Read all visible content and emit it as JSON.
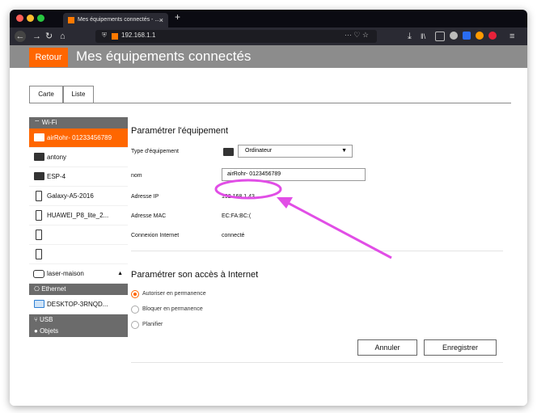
{
  "browser": {
    "tab_title": "Mes équipements connectés - ...",
    "tab_close": "×",
    "new_tab": "+",
    "url": "192.168.1.1",
    "url_menu": "··· ♡ ☆"
  },
  "page": {
    "back_label": "Retour",
    "title": "Mes équipements connectés",
    "tabs": [
      {
        "label": "Carte",
        "active": false
      },
      {
        "label": "Liste",
        "active": true
      }
    ]
  },
  "sidebar": {
    "wifi_label": "Wi-Fi",
    "wifi_items": [
      {
        "label": "airRohr- 01233456789",
        "icon": "computer-icon",
        "active": true
      },
      {
        "label": "antony",
        "icon": "computer-icon",
        "active": false
      },
      {
        "label": "ESP-4",
        "icon": "computer-icon",
        "active": false
      },
      {
        "label": "Galaxy-A5-2016",
        "icon": "phone-icon",
        "active": false
      },
      {
        "label": "HUAWEI_P8_lite_2...",
        "icon": "phone-icon",
        "active": false
      },
      {
        "label": "",
        "icon": "phone-icon",
        "active": false
      },
      {
        "label": "",
        "icon": "phone-icon",
        "active": false
      },
      {
        "label": "laser-maison",
        "icon": "printer-icon",
        "active": false
      }
    ],
    "ethernet_label": "Ethernet",
    "ethernet_items": [
      {
        "label": "DESKTOP-3RNQD...",
        "icon": "desktop-icon"
      }
    ],
    "usb_label": "USB",
    "objects_label": "Objets"
  },
  "settings": {
    "title": "Paramétrer l'équipement",
    "type_label": "Type d'équipement",
    "type_value": "Ordinateur",
    "name_label": "nom",
    "name_value": "airRohr- 0123456789",
    "ip_label": "Adresse IP",
    "ip_value": "192.168.1.43",
    "mac_label": "Adresse MAC",
    "mac_value": "EC:FA:BC:(",
    "connection_label": "Connexion Internet",
    "connection_value": "connecté"
  },
  "access": {
    "title": "Paramétrer son accès à Internet",
    "options": [
      {
        "label": "Autoriser en permanence",
        "selected": true
      },
      {
        "label": "Bloquer en permanence",
        "selected": false
      },
      {
        "label": "Planifier",
        "selected": false
      }
    ]
  },
  "buttons": {
    "cancel": "Annuler",
    "save": "Enregistrer"
  },
  "colors": {
    "orange": "#ff6600",
    "header_gray": "#8c8c8c",
    "annotation": "#e14ee6"
  }
}
